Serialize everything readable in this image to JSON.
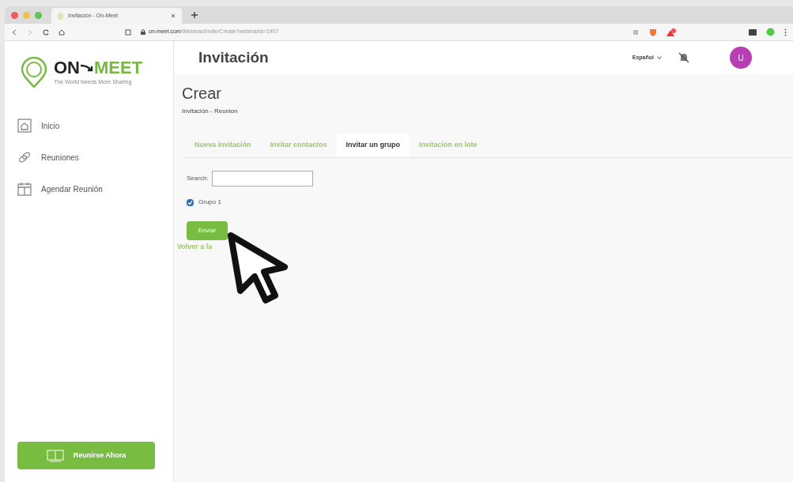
{
  "browser": {
    "tab_title": "Invitación - On-Meet",
    "url_host": "on-meet.com",
    "url_path": "/Webinar/Invite/Create?webinarId=1907"
  },
  "logo": {
    "word_left": "ON",
    "word_right": "MEET",
    "tagline": "The World Needs More Sharing"
  },
  "sidebar": {
    "items": [
      {
        "label": "Inicio",
        "kind": "home"
      },
      {
        "label": "Reuniones",
        "kind": "meetings"
      },
      {
        "label": "Agendar Reunión",
        "kind": "schedule"
      }
    ],
    "action_button": "Reunirse Ahora"
  },
  "header": {
    "title": "Invitación",
    "language": "Español",
    "avatar_letter": "U"
  },
  "page": {
    "title": "Crear",
    "breadcrumb": "Invitación - Reunion"
  },
  "tabs": [
    {
      "label": "Nueva invitación",
      "selected": false
    },
    {
      "label": "Invitar contactos",
      "selected": false
    },
    {
      "label": "Invitar un grupo",
      "selected": true
    },
    {
      "label": "Invitacion en lote",
      "selected": false
    }
  ],
  "search": {
    "label": "Search:"
  },
  "groups": [
    {
      "label": "Grupo 1",
      "checked": true
    }
  ],
  "submit_button": "Enviar",
  "back_link": "Volver a la"
}
